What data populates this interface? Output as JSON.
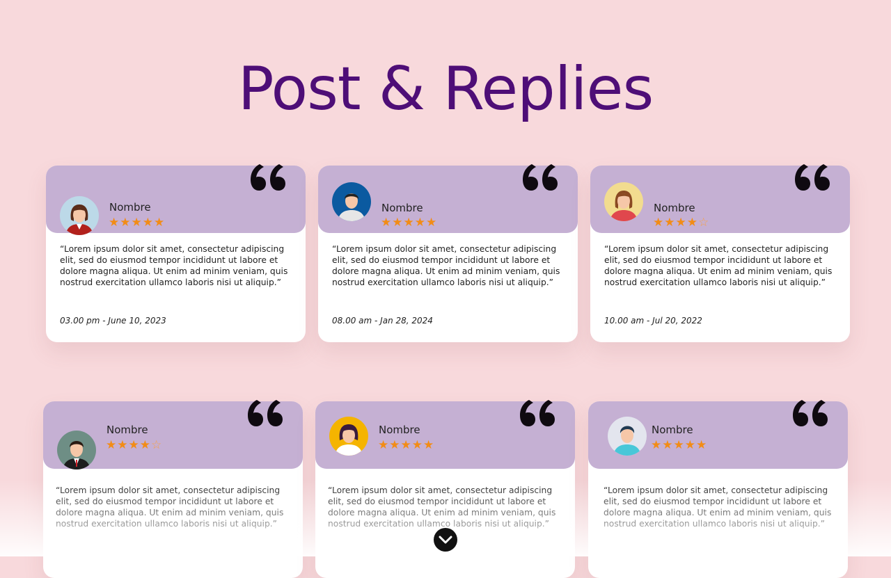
{
  "page": {
    "title": "Post & Replies"
  },
  "colors": {
    "background": "#f8d9dc",
    "title": "#4e0e77",
    "card_header": "#c5b0d3",
    "star": "#f28c16"
  },
  "cards": [
    {
      "name": "Nombre",
      "rating": 5,
      "avatar": "avatar-woman-red",
      "text": "“Lorem ipsum dolor sit amet, consectetur adipiscing elit, sed do eiusmod tempor incididunt ut labore et dolore magna aliqua. Ut enim ad minim veniam, quis nostrud exercitation ullamco laboris nisi ut aliquip.”",
      "date": "03.00 pm - June 10, 2023"
    },
    {
      "name": "Nombre",
      "rating": 5,
      "avatar": "avatar-man-blue",
      "text": "“Lorem ipsum dolor sit amet, consectetur adipiscing elit, sed do eiusmod tempor incididunt ut labore et dolore magna aliqua. Ut enim ad minim veniam, quis nostrud exercitation ullamco laboris nisi ut aliquip.”",
      "date": "08.00 am - Jan 28, 2024"
    },
    {
      "name": "Nombre",
      "rating": 4,
      "avatar": "avatar-woman-yellow",
      "text": "“Lorem ipsum dolor sit amet, consectetur adipiscing elit, sed do eiusmod tempor incididunt ut labore et dolore magna aliqua. Ut enim ad minim veniam, quis nostrud exercitation ullamco laboris nisi ut aliquip.”",
      "date": "10.00 am - Jul 20, 2022"
    },
    {
      "name": "Nombre",
      "rating": 4,
      "avatar": "avatar-man-suit",
      "text": "“Lorem ipsum dolor sit amet, consectetur adipiscing elit, sed do eiusmod tempor incididunt ut labore et dolore magna aliqua. Ut enim ad minim veniam, quis nostrud exercitation ullamco laboris nisi ut aliquip.”",
      "date": ""
    },
    {
      "name": "Nombre",
      "rating": 5,
      "avatar": "avatar-woman-orange",
      "text": "“Lorem ipsum dolor sit amet, consectetur adipiscing elit, sed do eiusmod tempor incididunt ut labore et dolore magna aliqua. Ut enim ad minim veniam, quis nostrud exercitation ullamco laboris nisi ut aliquip.”",
      "date": ""
    },
    {
      "name": "Nombre",
      "rating": 5,
      "avatar": "avatar-man-light",
      "text": "“Lorem ipsum dolor sit amet, consectetur adipiscing elit, sed do eiusmod tempor incididunt ut labore et dolore magna aliqua. Ut enim ad minim veniam, quis nostrud exercitation ullamco laboris nisi ut aliquip.”",
      "date": ""
    }
  ],
  "scroll_button": {
    "icon": "chevron-down-icon"
  }
}
